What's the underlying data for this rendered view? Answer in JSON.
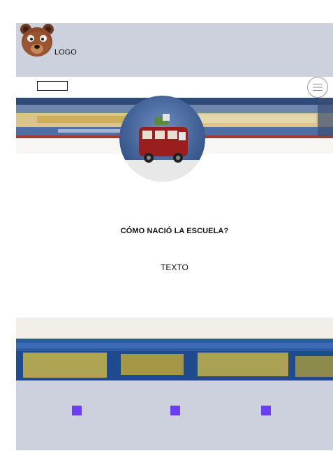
{
  "header": {
    "logo_icon": "bear-face-icon",
    "logo_text": "LOGO"
  },
  "nav": {
    "menu_icon": "hamburger-menu-icon"
  },
  "section": {
    "title": "CÓMO NACIÓ LA ESCUELA?",
    "body": "TEXTO"
  },
  "images": {
    "banner_top": "painted-banner",
    "avatar": "red-van-illustration",
    "banner_bottom": "painted-banner"
  },
  "footer": {
    "social_icons": [
      "social-icon-1",
      "social-icon-2",
      "social-icon-3"
    ],
    "icon_color": "#6b3df5"
  },
  "colors": {
    "header_bg": "#cdd1de",
    "footer_bg": "#cdd1de",
    "accent": "#6b3df5"
  }
}
